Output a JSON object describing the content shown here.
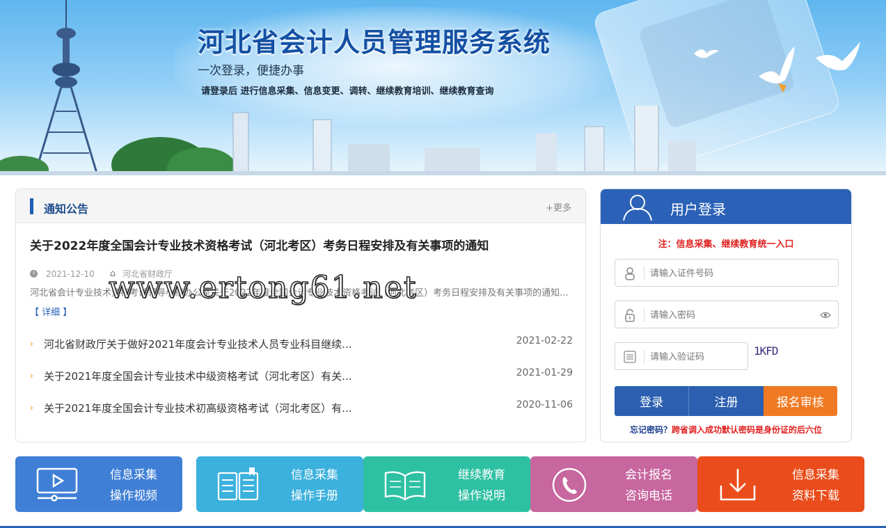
{
  "banner": {
    "title": "河北省会计人员管理服务系统",
    "subtitle": "一次登录，便捷办事",
    "description": "请登录后 进行信息采集、信息变更、调转、继续教育培训、继续教育查询"
  },
  "notice": {
    "header": "通知公告",
    "more": "+更多",
    "featured": {
      "title": "关于2022年度全国会计专业技术资格考试（河北考区）考务日程安排及有关事项的通知",
      "date": "2021-12-10",
      "source": "河北省财政厅",
      "summary": "河北省会计专业技术资格考试领导小组办公室关于2022年度全国会计专业技术资格考试（河北考区）考务日程安排及有关事项的通知...",
      "detail_link": "【 详细 】"
    },
    "items": [
      {
        "title": "河北省财政厅关于做好2021年度会计专业技术人员专业科目继续...",
        "date": "2021-02-22"
      },
      {
        "title": "关于2021年度全国会计专业技术中级资格考试（河北考区）有关...",
        "date": "2021-01-29"
      },
      {
        "title": "关于2021年度全国会计专业技术初高级资格考试（河北考区）有...",
        "date": "2020-11-06"
      }
    ]
  },
  "watermark": "www.ertong61.net",
  "login": {
    "header": "用户登录",
    "note": "注：信息采集、继续教育统一入口",
    "id_placeholder": "请输入证件号码",
    "password_placeholder": "请输入密码",
    "captcha_placeholder": "请输入验证码",
    "captcha_text": "1KFD",
    "login_button": "登录",
    "register_button": "注册",
    "review_button": "报名审核",
    "forgot_link": "忘记密码？",
    "forgot_note": "跨省调入成功默认密码是身份证的后六位"
  },
  "tiles": [
    {
      "line1": "信息采集",
      "line2": "操作视频",
      "icon": "video-player-icon",
      "color": "#3f7fd6"
    },
    {
      "line1": "信息采集",
      "line2": "操作手册",
      "icon": "manual-icon",
      "color": "#3cb1dd"
    },
    {
      "line1": "继续教育",
      "line2": "操作说明",
      "icon": "open-book-icon",
      "color": "#2ec0a3"
    },
    {
      "line1": "会计报名",
      "line2": "咨询电话",
      "icon": "phone-icon",
      "color": "#c7669f"
    },
    {
      "line1": "信息采集",
      "line2": "资料下载",
      "icon": "download-icon",
      "color": "#ea4d1b"
    }
  ]
}
